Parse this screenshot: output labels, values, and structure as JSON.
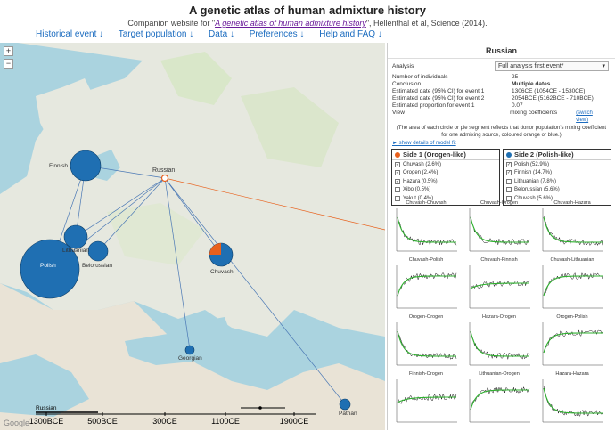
{
  "header": {
    "title": "A genetic atlas of human admixture history",
    "subtitle_prefix": "Companion website for \"",
    "subtitle_link": "A genetic atlas of human admixture history",
    "subtitle_suffix": "\", Hellenthal et al, Science (2014)."
  },
  "nav": [
    "Historical event ↓",
    "Target population ↓",
    "Data ↓",
    "Preferences ↓",
    "Help and FAQ ↓"
  ],
  "map": {
    "target_label": "Russian",
    "populations": [
      {
        "name": "Finnish",
        "color": "#1f6fb2"
      },
      {
        "name": "Polish",
        "color": "#1f6fb2"
      },
      {
        "name": "Lithuanian",
        "color": "#1f6fb2"
      },
      {
        "name": "Belorussian",
        "color": "#1f6fb2"
      },
      {
        "name": "Chuvash",
        "color": "#1f6fb2",
        "accent": "#e8601c",
        "accent_fraction": 0.25
      },
      {
        "name": "Georgian",
        "color": "#1f6fb2"
      },
      {
        "name": "Pathan",
        "color": "#1f6fb2"
      }
    ],
    "watermark": "Google"
  },
  "timeline": {
    "series_label": "Russian",
    "ticks": [
      "1300BCE",
      "500BCE",
      "300CE",
      "1100CE",
      "1900CE"
    ]
  },
  "panel": {
    "title": "Russian",
    "analysis_label": "Analysis",
    "analysis_value": "Full analysis first event*",
    "rows": [
      {
        "k": "Number of individuals",
        "v": "25"
      },
      {
        "k": "Conclusion",
        "v": "Multiple dates"
      },
      {
        "k": "Estimated date (95% CI) for event 1",
        "v": "1306CE (1054CE - 1530CE)"
      },
      {
        "k": "Estimated date (95% CI) for event 2",
        "v": "2054BCE (5162BCE - 710BCE)"
      },
      {
        "k": "Estimated proportion for event 1",
        "v": "0.07"
      },
      {
        "k": "View",
        "v": "mixing coefficients"
      }
    ],
    "switch_view": "(switch view)",
    "note": "(The area of each circle or pie segment reflects that donor population's mixing coefficient for one admixing source, coloured orange or blue.)",
    "show_details": "► show details of model fit",
    "side1": {
      "title": "Side 1 (Orogen-like)",
      "color": "#e8601c",
      "items": [
        {
          "label": "Chuvash (2.6%)",
          "checked": true
        },
        {
          "label": "Orogen (2.4%)",
          "checked": true
        },
        {
          "label": "Hazara (0.5%)",
          "checked": true
        },
        {
          "label": "Xibo (0.5%)",
          "checked": false
        },
        {
          "label": "Yakut (0.4%)",
          "checked": false
        }
      ]
    },
    "side2": {
      "title": "Side 2 (Polish-like)",
      "color": "#1f6fb2",
      "items": [
        {
          "label": "Polish (52.9%)",
          "checked": true
        },
        {
          "label": "Finnish (14.7%)",
          "checked": true
        },
        {
          "label": "Lithuanian (7.8%)",
          "checked": false
        },
        {
          "label": "Belorussian (5.6%)",
          "checked": false
        },
        {
          "label": "Chuvash (5.6%)",
          "checked": false
        }
      ]
    },
    "plots": [
      {
        "title": "Chuvash-Chuvash",
        "shape": "decay"
      },
      {
        "title": "Chuvash-Orogen",
        "shape": "decay"
      },
      {
        "title": "Chuvash-Hazara",
        "shape": "decay"
      },
      {
        "title": "Chuvash-Polish",
        "shape": "rise"
      },
      {
        "title": "Chuvash-Finnish",
        "shape": "flatnoisy"
      },
      {
        "title": "Chuvash-Lithuanian",
        "shape": "rise"
      },
      {
        "title": "Orogen-Orogen",
        "shape": "decay"
      },
      {
        "title": "Hazara-Orogen",
        "shape": "decay"
      },
      {
        "title": "Orogen-Polish",
        "shape": "rise"
      },
      {
        "title": "Finnish-Orogen",
        "shape": "flatnoisy"
      },
      {
        "title": "Lithuanian-Orogen",
        "shape": "rise"
      },
      {
        "title": "Hazara-Hazara",
        "shape": "decay"
      }
    ]
  }
}
